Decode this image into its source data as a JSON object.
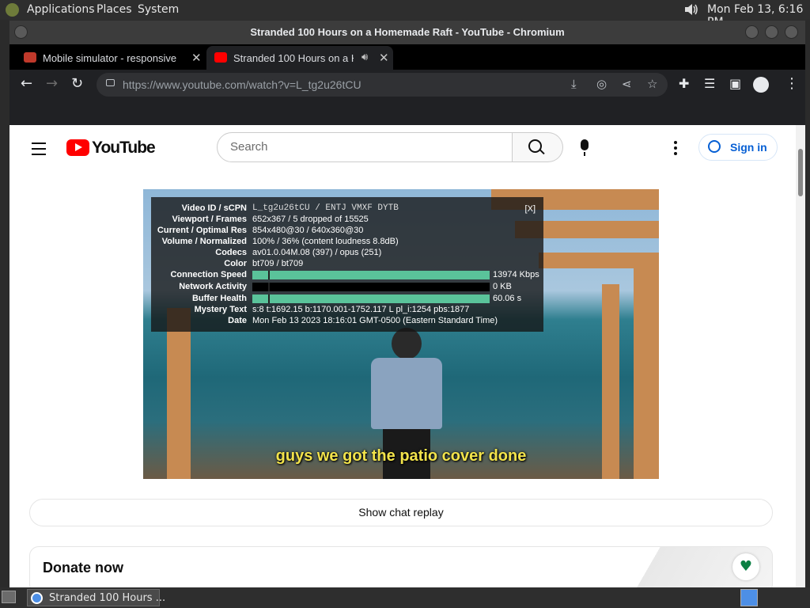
{
  "panel": {
    "menus": [
      "Applications",
      "Places",
      "System"
    ],
    "clock": "Mon Feb 13,  6:16 PM",
    "volume_icon": "speaker-icon"
  },
  "window": {
    "title": "Stranded 100 Hours on a Homemade Raft - YouTube - Chromium"
  },
  "tabs": [
    {
      "label": "Mobile simulator - responsive",
      "active": false
    },
    {
      "label": "Stranded 100 Hours on a H",
      "active": true,
      "audio": true
    }
  ],
  "toolbar": {
    "url": "https://www.youtube.com/watch?v=L_tg2u26tCU"
  },
  "youtube": {
    "logo_text": "YouTube",
    "search_placeholder": "Search",
    "signin_label": "Sign in"
  },
  "stats": {
    "close": "[X]",
    "rows": [
      {
        "k": "Video ID / sCPN",
        "v": "L_tg2u26tCU / ENTJ VMXF DYTB"
      },
      {
        "k": "Viewport / Frames",
        "v": "652x367 / 5 dropped of 15525"
      },
      {
        "k": "Current / Optimal Res",
        "v": "854x480@30 / 640x360@30"
      },
      {
        "k": "Volume / Normalized",
        "v": "100% / 36% (content loudness 8.8dB)"
      },
      {
        "k": "Codecs",
        "v": "av01.0.04M.08 (397) / opus (251)"
      },
      {
        "k": "Color",
        "v": "bt709 / bt709"
      },
      {
        "k": "Connection Speed",
        "v": "13974 Kbps",
        "fill": 1.0
      },
      {
        "k": "Network Activity",
        "v": "0 KB",
        "fill": 0.0
      },
      {
        "k": "Buffer Health",
        "v": "60.06 s",
        "fill": 1.0
      },
      {
        "k": "Mystery Text",
        "v": "s:8 t:1692.15 b:1170.001-1752.117 L pl_i:1254 pbs:1877"
      },
      {
        "k": "Date",
        "v": "Mon Feb 13 2023 18:16:01 GMT-0500 (Eastern Standard Time)"
      }
    ]
  },
  "video": {
    "caption": "guys we got the patio cover done"
  },
  "chat_replay_label": "Show chat replay",
  "donate": {
    "title": "Donate now"
  },
  "taskbar": {
    "task_label": "Stranded 100 Hours ..."
  }
}
